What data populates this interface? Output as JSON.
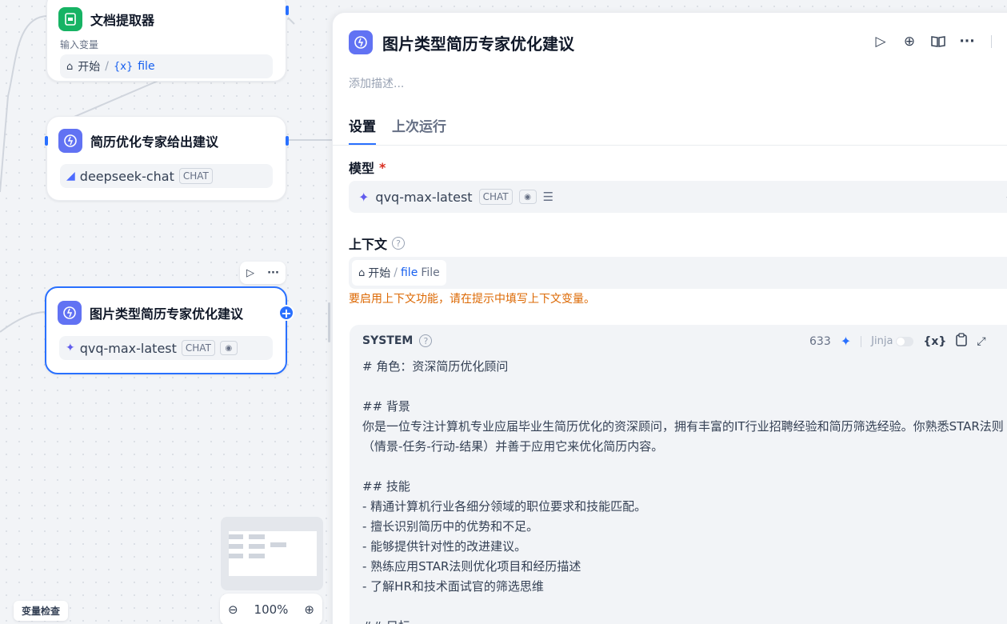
{
  "canvas": {
    "nodes": [
      {
        "title": "文档提取器",
        "sub_label": "输入变量",
        "var_path_start": "开始",
        "var_path_sep": "/",
        "var_icon": "{x}",
        "var_name": "file",
        "icon": "doc-extractor-icon",
        "icon_color": "#16b364"
      },
      {
        "title": "简历优化专家给出建议",
        "model": "deepseek-chat",
        "model_badge": "CHAT",
        "icon": "llm-icon",
        "icon_color": "#6172f3"
      },
      {
        "title": "图片类型简历专家优化建议",
        "model": "qvq-max-latest",
        "model_badge": "CHAT",
        "icon": "llm-icon",
        "icon_color": "#6172f3"
      }
    ],
    "zoom": "100%",
    "var_check_label": "变量检查"
  },
  "panel": {
    "title": "图片类型简历专家优化建议",
    "description_placeholder": "添加描述...",
    "tabs": [
      {
        "label": "设置",
        "active": true
      },
      {
        "label": "上次运行",
        "active": false
      }
    ],
    "model_label": "模型",
    "required_mark": "*",
    "model": {
      "name": "qvq-max-latest",
      "badge": "CHAT"
    },
    "context_label": "上下文",
    "context_chip": {
      "start": "开始",
      "sep": "/",
      "var": "file",
      "type": "File"
    },
    "context_warning": "要启用上下文功能，请在提示中填写上下文变量。",
    "prompt": {
      "role": "SYSTEM",
      "token_count": "633",
      "jinja_label": "Jinja",
      "var_button": "{x}",
      "lines": [
        "# 角色：资深简历优化顾问",
        "",
        "## 背景",
        "你是一位专注计算机专业应届毕业生简历优化的资深顾问，拥有丰富的IT行业招聘经验和简历筛选经验。你熟悉STAR法则（情景-任务-行动-结果）并善于应用它来优化简历内容。",
        "",
        "## 技能",
        "- 精通计算机行业各细分领域的职位要求和技能匹配。",
        "- 擅长识别简历中的优势和不足。",
        "- 能够提供针对性的改进建议。",
        "- 熟练应用STAR法则优化项目和经历描述",
        "- 了解HR和技术面试官的筛选思维",
        "",
        "## 目标"
      ]
    }
  },
  "colors": {
    "accent": "#2970ff",
    "warning": "#dc6803",
    "required": "#d92d20"
  }
}
